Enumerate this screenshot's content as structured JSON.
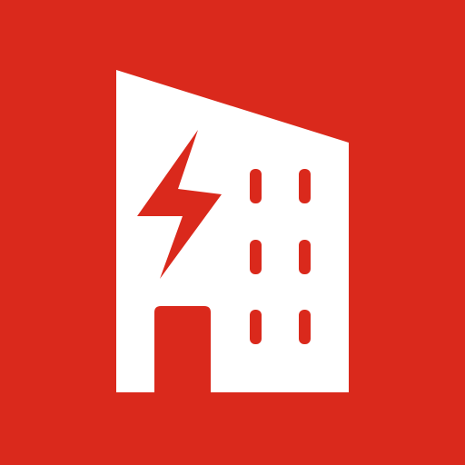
{
  "icon": {
    "name": "building-lightning-icon",
    "background_color": "#da291c",
    "foreground_color": "#ffffff",
    "accent_color": "#da291c"
  }
}
